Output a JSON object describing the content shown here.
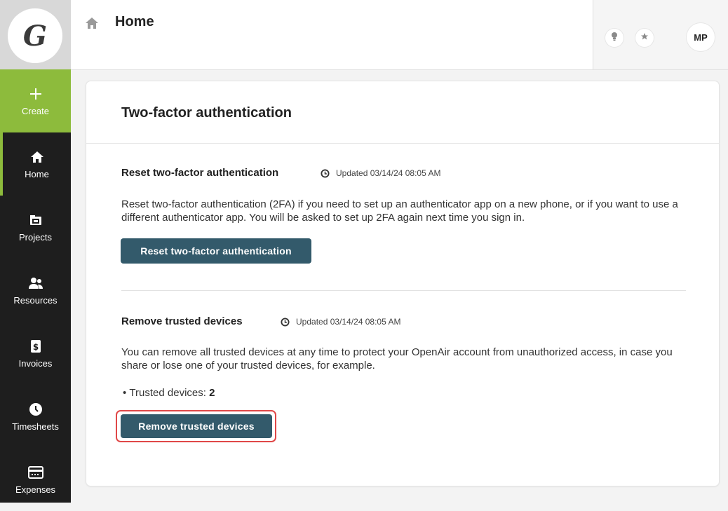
{
  "app": {
    "logo_letter": "G"
  },
  "sidebar": {
    "items": [
      {
        "label": "Create",
        "icon": "plus-icon"
      },
      {
        "label": "Home",
        "icon": "home-icon"
      },
      {
        "label": "Projects",
        "icon": "projects-icon"
      },
      {
        "label": "Resources",
        "icon": "resources-icon"
      },
      {
        "label": "Invoices",
        "icon": "invoices-icon"
      },
      {
        "label": "Timesheets",
        "icon": "clock-icon"
      },
      {
        "label": "Expenses",
        "icon": "expenses-icon"
      }
    ],
    "colors": {
      "background": "#1e1e1e",
      "create_bg": "#8dbb3c",
      "active_accent": "#8dbb3c"
    }
  },
  "header": {
    "breadcrumb_icon": "home-icon",
    "title": "Home",
    "user_initials": "MP"
  },
  "main": {
    "card_title": "Two-factor authentication",
    "reset_section": {
      "title": "Reset two-factor authentication",
      "updated": "Updated 03/14/24 08:05 AM",
      "description": "Reset two-factor authentication (2FA) if you need to set up an authenticator app on a new phone, or if you want to use a different authenticator app. You will be asked to set up 2FA again next time you sign in.",
      "button_label": "Reset two-factor authentication"
    },
    "trusted_section": {
      "title": "Remove trusted devices",
      "updated": "Updated 03/14/24 08:05 AM",
      "description": "You can remove all trusted devices at any time to protect your OpenAir account from unauthorized access, in case you share or lose one of your trusted devices, for example.",
      "devices_label": "Trusted devices: ",
      "devices_count": "2",
      "button_label": "Remove trusted devices"
    },
    "colors": {
      "button": "#335a6b",
      "focus_ring": "#e04848"
    }
  }
}
